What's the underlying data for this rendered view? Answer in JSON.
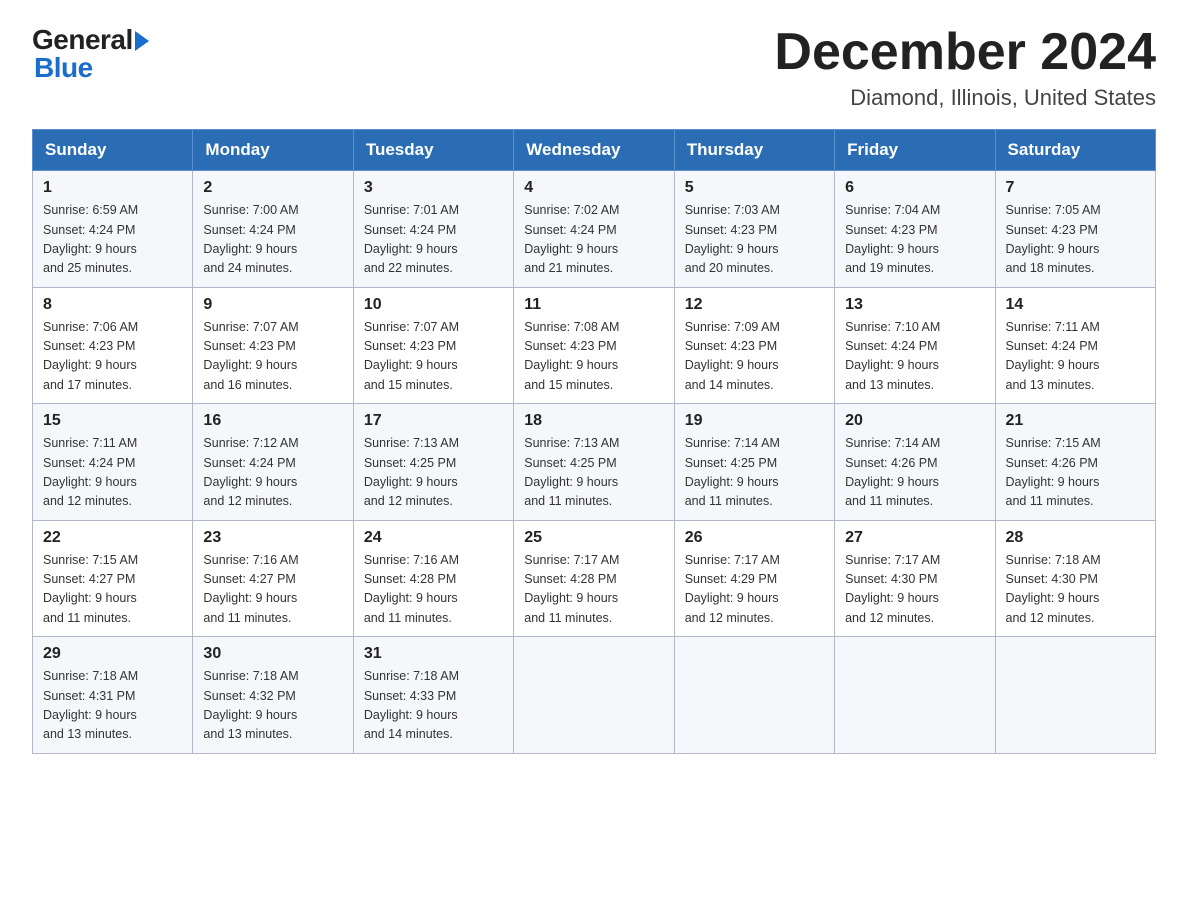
{
  "header": {
    "logo_general": "General",
    "logo_blue": "Blue",
    "title": "December 2024",
    "subtitle": "Diamond, Illinois, United States"
  },
  "days_of_week": [
    "Sunday",
    "Monday",
    "Tuesday",
    "Wednesday",
    "Thursday",
    "Friday",
    "Saturday"
  ],
  "weeks": [
    [
      {
        "day": "1",
        "sunrise": "6:59 AM",
        "sunset": "4:24 PM",
        "daylight": "9 hours and 25 minutes."
      },
      {
        "day": "2",
        "sunrise": "7:00 AM",
        "sunset": "4:24 PM",
        "daylight": "9 hours and 24 minutes."
      },
      {
        "day": "3",
        "sunrise": "7:01 AM",
        "sunset": "4:24 PM",
        "daylight": "9 hours and 22 minutes."
      },
      {
        "day": "4",
        "sunrise": "7:02 AM",
        "sunset": "4:24 PM",
        "daylight": "9 hours and 21 minutes."
      },
      {
        "day": "5",
        "sunrise": "7:03 AM",
        "sunset": "4:23 PM",
        "daylight": "9 hours and 20 minutes."
      },
      {
        "day": "6",
        "sunrise": "7:04 AM",
        "sunset": "4:23 PM",
        "daylight": "9 hours and 19 minutes."
      },
      {
        "day": "7",
        "sunrise": "7:05 AM",
        "sunset": "4:23 PM",
        "daylight": "9 hours and 18 minutes."
      }
    ],
    [
      {
        "day": "8",
        "sunrise": "7:06 AM",
        "sunset": "4:23 PM",
        "daylight": "9 hours and 17 minutes."
      },
      {
        "day": "9",
        "sunrise": "7:07 AM",
        "sunset": "4:23 PM",
        "daylight": "9 hours and 16 minutes."
      },
      {
        "day": "10",
        "sunrise": "7:07 AM",
        "sunset": "4:23 PM",
        "daylight": "9 hours and 15 minutes."
      },
      {
        "day": "11",
        "sunrise": "7:08 AM",
        "sunset": "4:23 PM",
        "daylight": "9 hours and 15 minutes."
      },
      {
        "day": "12",
        "sunrise": "7:09 AM",
        "sunset": "4:23 PM",
        "daylight": "9 hours and 14 minutes."
      },
      {
        "day": "13",
        "sunrise": "7:10 AM",
        "sunset": "4:24 PM",
        "daylight": "9 hours and 13 minutes."
      },
      {
        "day": "14",
        "sunrise": "7:11 AM",
        "sunset": "4:24 PM",
        "daylight": "9 hours and 13 minutes."
      }
    ],
    [
      {
        "day": "15",
        "sunrise": "7:11 AM",
        "sunset": "4:24 PM",
        "daylight": "9 hours and 12 minutes."
      },
      {
        "day": "16",
        "sunrise": "7:12 AM",
        "sunset": "4:24 PM",
        "daylight": "9 hours and 12 minutes."
      },
      {
        "day": "17",
        "sunrise": "7:13 AM",
        "sunset": "4:25 PM",
        "daylight": "9 hours and 12 minutes."
      },
      {
        "day": "18",
        "sunrise": "7:13 AM",
        "sunset": "4:25 PM",
        "daylight": "9 hours and 11 minutes."
      },
      {
        "day": "19",
        "sunrise": "7:14 AM",
        "sunset": "4:25 PM",
        "daylight": "9 hours and 11 minutes."
      },
      {
        "day": "20",
        "sunrise": "7:14 AM",
        "sunset": "4:26 PM",
        "daylight": "9 hours and 11 minutes."
      },
      {
        "day": "21",
        "sunrise": "7:15 AM",
        "sunset": "4:26 PM",
        "daylight": "9 hours and 11 minutes."
      }
    ],
    [
      {
        "day": "22",
        "sunrise": "7:15 AM",
        "sunset": "4:27 PM",
        "daylight": "9 hours and 11 minutes."
      },
      {
        "day": "23",
        "sunrise": "7:16 AM",
        "sunset": "4:27 PM",
        "daylight": "9 hours and 11 minutes."
      },
      {
        "day": "24",
        "sunrise": "7:16 AM",
        "sunset": "4:28 PM",
        "daylight": "9 hours and 11 minutes."
      },
      {
        "day": "25",
        "sunrise": "7:17 AM",
        "sunset": "4:28 PM",
        "daylight": "9 hours and 11 minutes."
      },
      {
        "day": "26",
        "sunrise": "7:17 AM",
        "sunset": "4:29 PM",
        "daylight": "9 hours and 12 minutes."
      },
      {
        "day": "27",
        "sunrise": "7:17 AM",
        "sunset": "4:30 PM",
        "daylight": "9 hours and 12 minutes."
      },
      {
        "day": "28",
        "sunrise": "7:18 AM",
        "sunset": "4:30 PM",
        "daylight": "9 hours and 12 minutes."
      }
    ],
    [
      {
        "day": "29",
        "sunrise": "7:18 AM",
        "sunset": "4:31 PM",
        "daylight": "9 hours and 13 minutes."
      },
      {
        "day": "30",
        "sunrise": "7:18 AM",
        "sunset": "4:32 PM",
        "daylight": "9 hours and 13 minutes."
      },
      {
        "day": "31",
        "sunrise": "7:18 AM",
        "sunset": "4:33 PM",
        "daylight": "9 hours and 14 minutes."
      },
      null,
      null,
      null,
      null
    ]
  ],
  "labels": {
    "sunrise": "Sunrise: ",
    "sunset": "Sunset: ",
    "daylight": "Daylight: "
  }
}
